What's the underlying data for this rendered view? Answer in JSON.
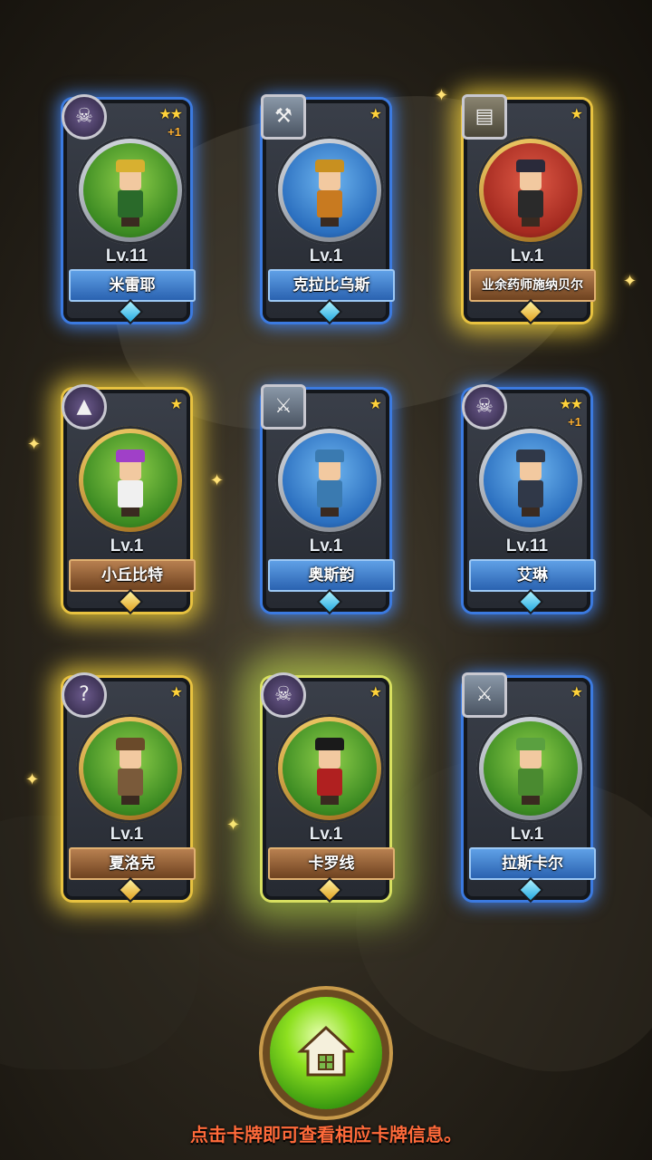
{
  "cards": [
    {
      "name": "米雷耶",
      "level": "Lv.11",
      "stars": "★★",
      "plus": "+1",
      "class_icon": "skull-icon",
      "glow": "blue",
      "banner": "blue",
      "portrait": "green",
      "gem": "blue"
    },
    {
      "name": "克拉比乌斯",
      "level": "Lv.1",
      "stars": "★",
      "plus": "",
      "class_icon": "axe-icon",
      "glow": "blue",
      "banner": "blue",
      "portrait": "blue",
      "gem": "blue"
    },
    {
      "name": "业余药师施纳贝尔",
      "level": "Lv.1",
      "stars": "★",
      "plus": "",
      "class_icon": "book-icon",
      "glow": "gold",
      "banner": "brown",
      "portrait": "red",
      "gem": "gold"
    },
    {
      "name": "小丘比特",
      "level": "Lv.1",
      "stars": "★",
      "plus": "",
      "class_icon": "witch-hat-icon",
      "glow": "gold",
      "banner": "brown",
      "portrait": "green",
      "gem": "gold"
    },
    {
      "name": "奥斯韵",
      "level": "Lv.1",
      "stars": "★",
      "plus": "",
      "class_icon": "crossed-swords-icon",
      "glow": "blue",
      "banner": "blue",
      "portrait": "blue",
      "gem": "blue"
    },
    {
      "name": "艾琳",
      "level": "Lv.11",
      "stars": "★★",
      "plus": "+1",
      "class_icon": "skull-icon",
      "glow": "blue",
      "banner": "blue",
      "portrait": "blue",
      "gem": "blue"
    },
    {
      "name": "夏洛克",
      "level": "Lv.1",
      "stars": "★",
      "plus": "",
      "class_icon": "question-mark-icon",
      "glow": "gold",
      "banner": "brown",
      "portrait": "green",
      "gem": "gold"
    },
    {
      "name": "卡罗线",
      "level": "Lv.1",
      "stars": "★",
      "plus": "",
      "class_icon": "skull-icon",
      "glow": "green",
      "banner": "brown",
      "portrait": "green",
      "gem": "gold"
    },
    {
      "name": "拉斯卡尔",
      "level": "Lv.1",
      "stars": "★",
      "plus": "",
      "class_icon": "crossed-swords-icon",
      "glow": "blue",
      "banner": "blue",
      "portrait": "green",
      "gem": "blue"
    }
  ],
  "home_button": {
    "icon": "home-icon"
  },
  "hint_text": "点击卡牌即可查看相应卡牌信息。",
  "colors": {
    "hint": "#ff6a3a",
    "blue_glow": "#3b7ae0",
    "gold_glow": "#e8c240"
  }
}
